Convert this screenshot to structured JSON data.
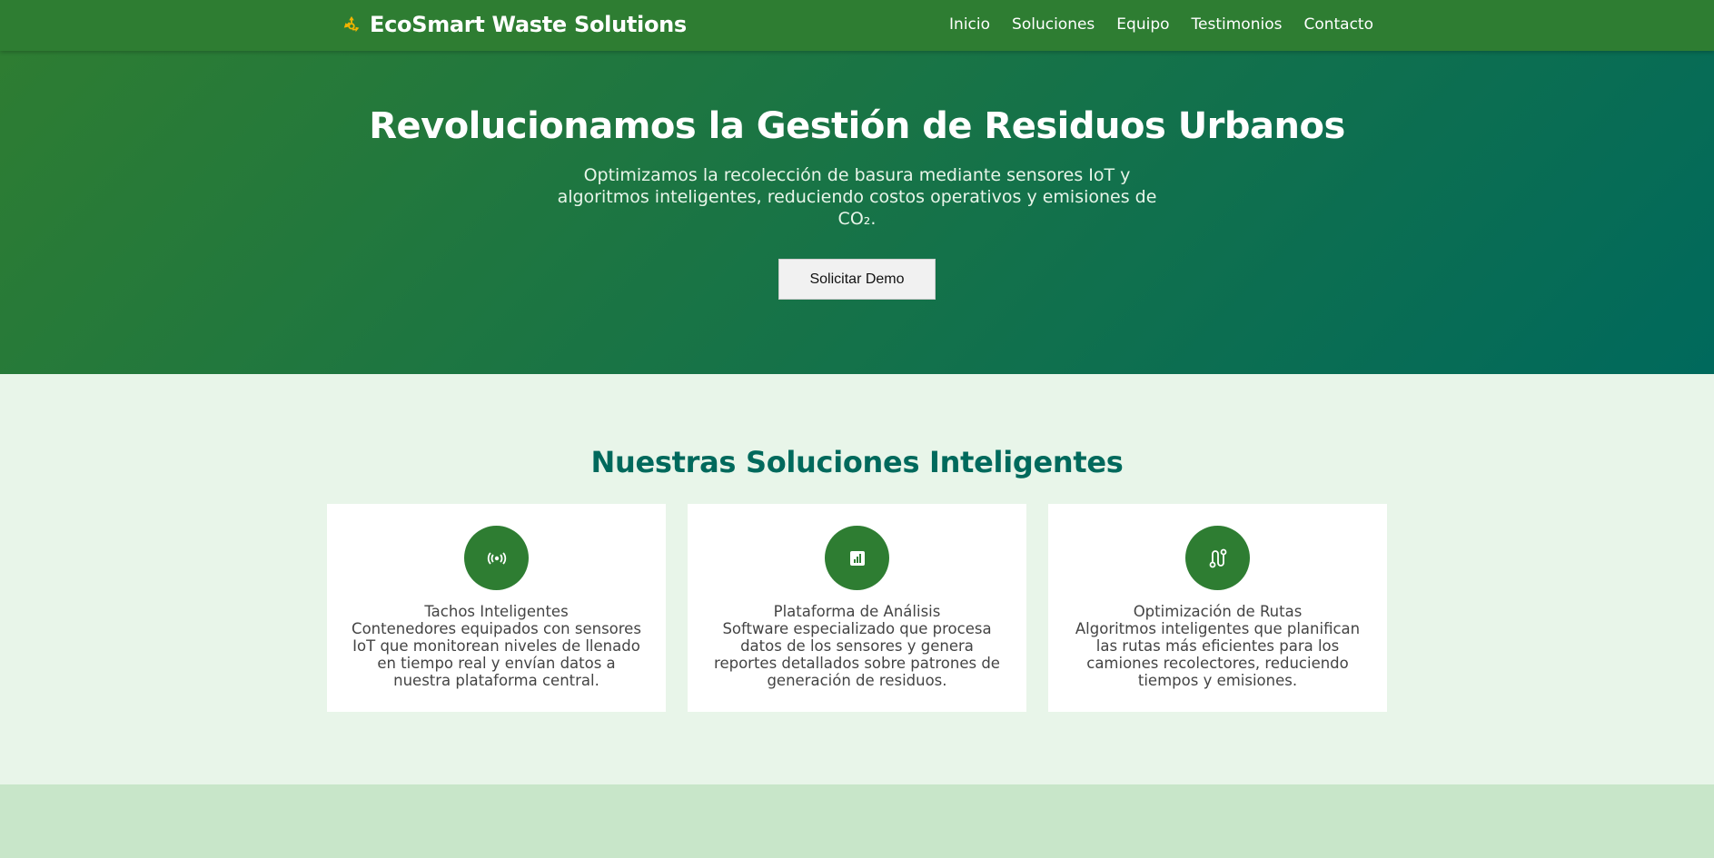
{
  "nav": {
    "brand": "EcoSmart Waste Solutions",
    "brand_icon": "recycle-icon",
    "links": [
      "Inicio",
      "Soluciones",
      "Equipo",
      "Testimonios",
      "Contacto"
    ]
  },
  "hero": {
    "title": "Revolucionamos la Gestión de Residuos Urbanos",
    "subtitle": "Optimizamos la recolección de basura mediante sensores IoT y algoritmos inteligentes, reduciendo costos operativos y emisiones de CO₂.",
    "cta": "Solicitar Demo"
  },
  "solutions": {
    "title": "Nuestras Soluciones Inteligentes",
    "cards": [
      {
        "icon": "wireless-sensor-icon",
        "title": "Tachos Inteligentes",
        "description": "Contenedores equipados con sensores IoT que monitorean niveles de llenado en tiempo real y envían datos a nuestra plataforma central."
      },
      {
        "icon": "analytics-chart-icon",
        "title": "Plataforma de Análisis",
        "description": "Software especializado que procesa datos de los sensores y genera reportes detallados sobre patrones de generación de residuos."
      },
      {
        "icon": "route-icon",
        "title": "Optimización de Rutas",
        "description": "Algoritmos inteligentes que planifican las rutas más eficientes para los camiones recolectores, reduciendo tiempos y emisiones."
      }
    ]
  },
  "colors": {
    "primary": "#2e7d32",
    "secondary": "#00695c",
    "light_bg": "#e8f5e9",
    "band_bg": "#c8e6c9",
    "accent_icon": "#f4b400"
  }
}
